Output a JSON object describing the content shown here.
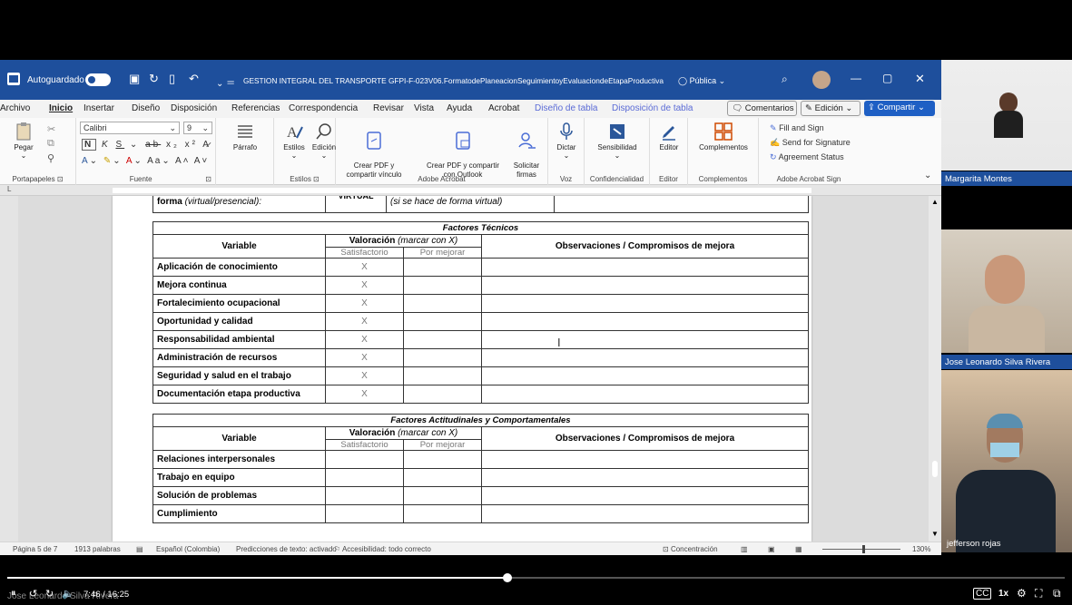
{
  "titlebar": {
    "autosave": "Autoguardado",
    "doc_title": "GESTION INTEGRAL DEL TRANSPORTE GFPI-F-023V06.FormatodePlaneacionSeguimientoyEvaluaciondeEtapaProductiva",
    "visibility": "Pública"
  },
  "menu": {
    "items": [
      "Archivo",
      "Inicio",
      "Insertar",
      "Diseño",
      "Disposición",
      "Referencias",
      "Correspondencia",
      "Revisar",
      "Vista",
      "Ayuda",
      "Acrobat",
      "Diseño de tabla",
      "Disposición de tabla"
    ],
    "comments": "Comentarios",
    "editing": "Edición",
    "share": "Compartir"
  },
  "ribbon": {
    "paste": "Pegar",
    "clipboard": "Portapapeles",
    "font_name": "Calibri",
    "font_size": "9",
    "font_group": "Fuente",
    "paragraph": "Párrafo",
    "styles": "Estilos",
    "styles_group": "Estilos",
    "editing": "Edición",
    "create_pdf": "Crear PDF y\ncompartir vínculo",
    "create_pdf_outlook": "Crear PDF y compartir\ncon Outlook",
    "request_sign": "Solicitar\nfirmas",
    "acrobat_group": "Adobe Acrobat",
    "dictate": "Dictar",
    "voice_group": "Voz",
    "sensitivity": "Sensibilidad",
    "conf_group": "Confidencialidad",
    "editor": "Editor",
    "editor_group": "Editor",
    "addins": "Complementos",
    "addins_group": "Complementos",
    "fill_sign": "Fill and Sign",
    "send_sig": "Send for Signature",
    "agreement": "Agreement Status",
    "sign_group": "Adobe Acrobat Sign"
  },
  "document": {
    "top_row": {
      "label": "forma",
      "label_it": " (virtual/presencial):",
      "value": "VIRTUAL",
      "note": "(si se hace de forma virtual)"
    },
    "sections": [
      {
        "title": "Factores Técnicos",
        "header_variable": "Variable",
        "header_valoracion": "Valoración",
        "header_marcar": " (marcar con X)",
        "header_obs": "Observaciones / Compromisos de mejora",
        "sub_sat": "Satisfactorio",
        "sub_mej": "Por mejorar",
        "rows": [
          {
            "variable": "Aplicación de conocimiento",
            "sat": "X",
            "mej": "",
            "obs": ""
          },
          {
            "variable": "Mejora continua",
            "sat": "X",
            "mej": "",
            "obs": ""
          },
          {
            "variable": "Fortalecimiento ocupacional",
            "sat": "X",
            "mej": "",
            "obs": ""
          },
          {
            "variable": "Oportunidad y calidad",
            "sat": "X",
            "mej": "",
            "obs": ""
          },
          {
            "variable": "Responsabilidad ambiental",
            "sat": "X",
            "mej": "",
            "obs": ""
          },
          {
            "variable": "Administración de recursos",
            "sat": "X",
            "mej": "",
            "obs": ""
          },
          {
            "variable": "Seguridad y salud en el trabajo",
            "sat": "X",
            "mej": "",
            "obs": ""
          },
          {
            "variable": "Documentación etapa productiva",
            "sat": "X",
            "mej": "",
            "obs": ""
          }
        ]
      },
      {
        "title": "Factores Actitudinales y Comportamentales",
        "header_variable": "Variable",
        "header_valoracion": "Valoración",
        "header_marcar": " (marcar con X)",
        "header_obs": "Observaciones / Compromisos de mejora",
        "sub_sat": "Satisfactorio",
        "sub_mej": "Por mejorar",
        "rows": [
          {
            "variable": "Relaciones interpersonales",
            "sat": "",
            "mej": "",
            "obs": ""
          },
          {
            "variable": "Trabajo en equipo",
            "sat": "",
            "mej": "",
            "obs": ""
          },
          {
            "variable": "Solución de problemas",
            "sat": "",
            "mej": "",
            "obs": ""
          },
          {
            "variable": "Cumplimiento",
            "sat": "",
            "mej": "",
            "obs": ""
          }
        ]
      }
    ]
  },
  "status": {
    "page": "Página 5 de 7",
    "words": "1913 palabras",
    "language": "Español (Colombia)",
    "predictions": "Predicciones de texto: activado",
    "accessibility": "Accesibilidad: todo correcto",
    "focus": "Concentración",
    "zoom": "130%"
  },
  "participants": [
    {
      "name": "Margarita Montes"
    },
    {
      "name": "Jose Leonardo Silva Rivera"
    },
    {
      "name": "jefferson rojas"
    }
  ],
  "player": {
    "time": "7:46 / 16:25",
    "speed": "1x",
    "progress": 0.473,
    "speaker_caption": "Jose Leonardo Silva Rivera"
  },
  "colors": {
    "word_blue": "#1e4f9c",
    "accent": "#2b579a"
  }
}
